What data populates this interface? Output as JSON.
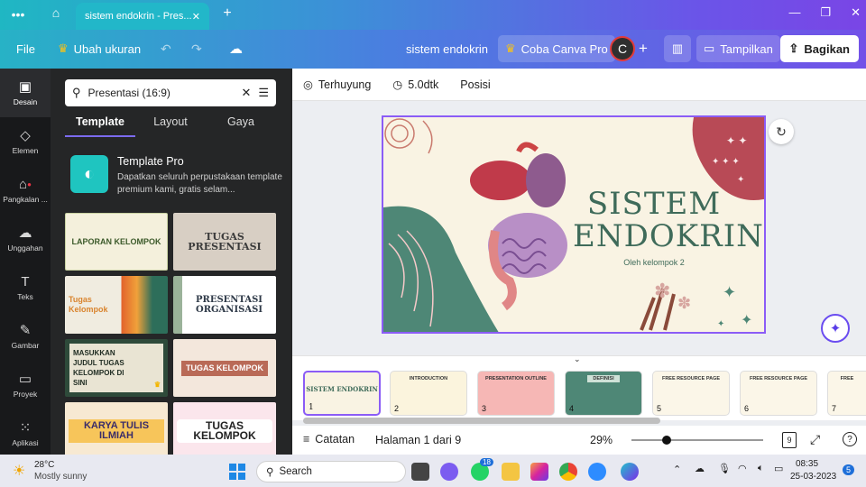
{
  "browser": {
    "tab_title": "sistem endokrin - Pres...",
    "new_tab": "+",
    "menu_icon": "dots-icon",
    "home_icon": "home-icon"
  },
  "header": {
    "file": "File",
    "resize": "Ubah ukuran",
    "doc_title": "sistem endokrin",
    "pro": "Coba Canva Pro",
    "avatar": "C",
    "present": "Tampilkan",
    "share": "Bagikan"
  },
  "rail": {
    "items": [
      {
        "label": "Desain",
        "icon": "layout-icon"
      },
      {
        "label": "Elemen",
        "icon": "shapes-icon"
      },
      {
        "label": "Pangkalan ...",
        "icon": "brand-icon"
      },
      {
        "label": "Unggahan",
        "icon": "upload-icon"
      },
      {
        "label": "Teks",
        "icon": "text-icon"
      },
      {
        "label": "Gambar",
        "icon": "draw-icon"
      },
      {
        "label": "Proyek",
        "icon": "folder-icon"
      },
      {
        "label": "Aplikasi",
        "icon": "apps-icon"
      }
    ]
  },
  "panel": {
    "search_value": "Presentasi (16:9)",
    "tabs": [
      "Template",
      "Layout",
      "Gaya"
    ],
    "pro_title": "Template Pro",
    "pro_desc": "Dapatkan seluruh perpustakaan template premium kami, gratis selam...",
    "thumbs": [
      {
        "text": "LAPORAN KELOMPOK",
        "bg": "#f4f0dc",
        "fg": "#3c5a2a"
      },
      {
        "text": "TUGAS PRESENTASI",
        "bg": "#d8cfc4",
        "fg": "#3a3a3a"
      },
      {
        "text": "Tugas Kelompok",
        "bg": "#f0ece0",
        "fg": "#d9842e"
      },
      {
        "text": "PRESENTASI ORGANISASI",
        "bg": "#ffffff",
        "fg": "#2f3a48"
      },
      {
        "text": "MASUKKAN JUDUL TUGAS KELOMPOK DI SINI",
        "bg": "#e9e4d3",
        "fg": "#1d2a20"
      },
      {
        "text": "TUGAS KELOMPOK",
        "bg": "#f3e7dc",
        "fg": "#ffffff"
      },
      {
        "text": "KARYA TULIS ILMIAH",
        "bg": "#f7e9d2",
        "fg": "#3a2c6a"
      },
      {
        "text": "TUGAS KELOMPOK",
        "bg": "#fbe6ec",
        "fg": "#222222"
      }
    ]
  },
  "context": {
    "anim": "Terhuyung",
    "duration": "5.0dtk",
    "position": "Posisi"
  },
  "slide": {
    "title": "SISTEM ENDOKRIN",
    "subtitle": "Oleh kelompok 2"
  },
  "pages": [
    {
      "num": "1",
      "label": "SISTEM ENDOKRIN",
      "bg": "#f9f3e3"
    },
    {
      "num": "2",
      "label": "INTRODUCTION",
      "bg": "#fbf4dd"
    },
    {
      "num": "3",
      "label": "PRESENTATION OUTLINE",
      "bg": "#f6b7b5"
    },
    {
      "num": "4",
      "label": "DEFINISI",
      "bg": "#4e8776"
    },
    {
      "num": "5",
      "label": "FREE RESOURCE PAGE",
      "bg": "#fbf6e8"
    },
    {
      "num": "6",
      "label": "FREE RESOURCE PAGE",
      "bg": "#fbf6e8"
    },
    {
      "num": "7",
      "label": "FREE",
      "bg": "#fbf6e8"
    }
  ],
  "bottom": {
    "notes": "Catatan",
    "page_info": "Halaman 1 dari 9",
    "zoom": "29%",
    "page_count": "9"
  },
  "taskbar": {
    "temp": "28°C",
    "weather": "Mostly sunny",
    "search": "Search",
    "whatsapp_badge": "18",
    "time": "08:35",
    "date": "25-03-2023",
    "notif": "5"
  }
}
